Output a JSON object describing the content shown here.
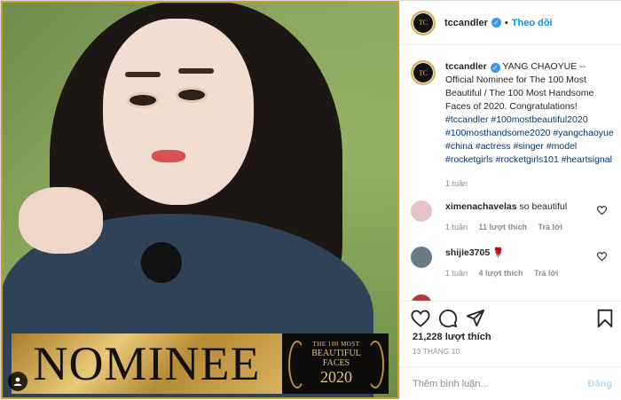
{
  "photo": {
    "banner_word": "NOMINEE",
    "seal_line1": "THE 100 MOST",
    "seal_line2": "BEAUTIFUL",
    "seal_line3": "FACES",
    "seal_year": "2020"
  },
  "header": {
    "username": "tccandler",
    "separator": "•",
    "follow_label": "Theo dõi",
    "verified_mark": "✓"
  },
  "caption": {
    "username": "tccandler",
    "body": "YANG CHAOYUE -- Official Nominee for The 100 Most Beautiful / The 100 Most Handsome Faces of 2020. Congratulations!",
    "hashtags": "#tccandler #100mostbeautiful2020 #100mosthandsome2020 #yangchaoyue #china #actress #singer #model #rocketgirls #rocketgirls101 #heartsignal",
    "age": "1 tuần"
  },
  "comments": [
    {
      "username": "ximenachavelas",
      "text": "so beautiful",
      "age": "1 tuần",
      "likes": "11 lượt thích",
      "reply": "Trả lời",
      "avatar_color": "#e6c3c7"
    },
    {
      "username": "shijie3705",
      "text": "🌹",
      "age": "1 tuần",
      "likes": "4 lượt thích",
      "reply": "Trả lời",
      "avatar_color": "#6b7a88"
    }
  ],
  "actions": {
    "likes": "21,228 lượt thích",
    "date": "13 THÁNG 10",
    "comment_placeholder": "Thêm bình luận...",
    "post_label": "Đăng"
  },
  "icons": {
    "like": "heart-icon",
    "comment": "comment-icon",
    "share": "share-icon",
    "save": "bookmark-icon",
    "user_tag": "user-icon"
  },
  "colors": {
    "link_blue": "#0095f6",
    "hashtag": "#00376b",
    "muted": "#8e8e8e",
    "verified": "#3897f0"
  }
}
